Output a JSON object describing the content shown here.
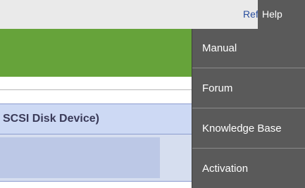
{
  "header": {
    "refresh_label": "Refresh",
    "help_label": "Help"
  },
  "content": {
    "disk_title": "SCSI Disk Device)"
  },
  "help_menu": {
    "items": [
      {
        "label": "Manual"
      },
      {
        "label": "Forum"
      },
      {
        "label": "Knowledge Base"
      },
      {
        "label": "Activation"
      }
    ]
  },
  "colors": {
    "menu_background": "#5a5a5a",
    "top_bar": "#eaeaea",
    "green_band": "#66a33a",
    "disk_row": "#cdd9f4",
    "link": "#2a4f9e"
  }
}
